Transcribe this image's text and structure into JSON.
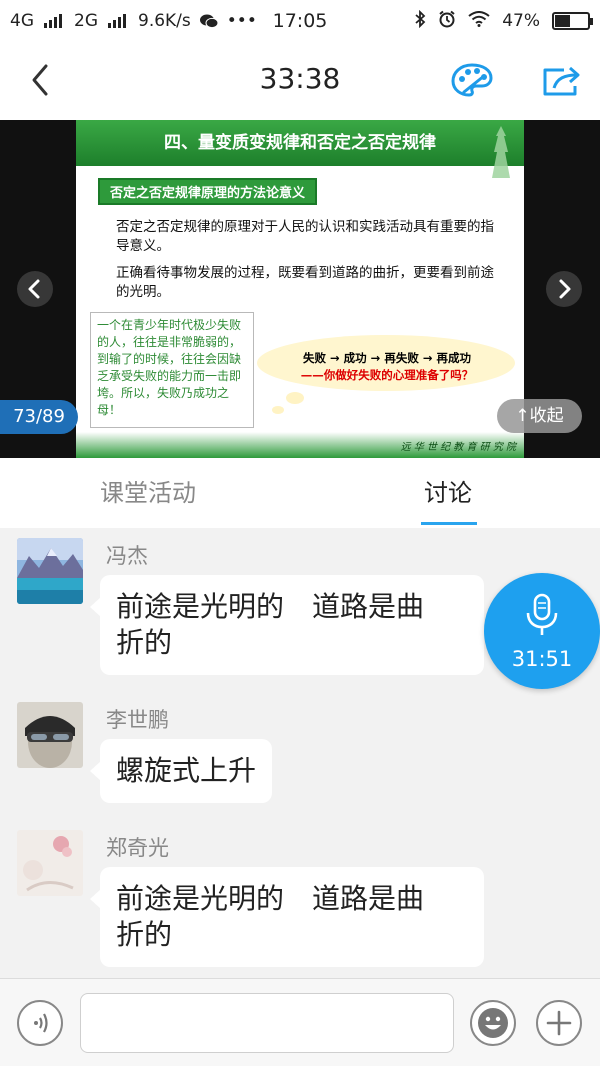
{
  "status_bar": {
    "network_1": "4G",
    "network_2": "2G",
    "speed": "9.6K/s",
    "more": "•••",
    "time": "17:05",
    "battery": "47%",
    "battery_level": 0.47
  },
  "header": {
    "title": "33:38",
    "back_icon": "chevron-left-icon",
    "palette_icon": "palette-icon",
    "share_icon": "share-icon",
    "accent_color": "#1e9be9"
  },
  "slide": {
    "title": "四、量变质变规律和否定之否定规律",
    "subtitle": "否定之否定规律原理的方法论意义",
    "paragraph_1": "否定之否定规律的原理对于人民的认识和实践活动具有重要的指导意义。",
    "paragraph_2": "正确看待事物发展的过程，既要看到道路的曲折，更要看到前途的光明。",
    "box_text": "一个在青少年时代极少失败的人，往往是非常脆弱的，到输了的时候，往往会因缺乏承受失败的能力而一击即垮。所以，失败乃成功之母！",
    "flow": "失败 → 成功 → 再失败 → 再成功",
    "flow_question": "——你做好失败的心理准备了吗？",
    "footer_text": "远 华 世 纪 教 育 研 究 院",
    "page_indicator": "73/89",
    "collapse_label": "↑收起",
    "prev_icon": "chevron-left-icon",
    "next_icon": "chevron-right-icon"
  },
  "tabs": [
    {
      "label": "课堂活动",
      "active": false
    },
    {
      "label": "讨论",
      "active": true
    }
  ],
  "messages": [
    {
      "sender": "冯杰",
      "lines": [
        "前途是光明的　道路是曲",
        "折的"
      ],
      "avatar": "mountain-lake-avatar"
    },
    {
      "sender": "李世鹏",
      "lines": [
        "螺旋式上升"
      ],
      "avatar": "person-avatar"
    },
    {
      "sender": "郑奇光",
      "lines": [
        "前途是光明的　道路是曲",
        "折的"
      ],
      "avatar": "floral-avatar"
    }
  ],
  "recorder": {
    "time": "31:51",
    "icon": "microphone-icon"
  },
  "bottom_bar": {
    "input_value": "",
    "input_placeholder": "",
    "voice_icon": "voice-icon",
    "emoji_icon": "emoji-icon",
    "plus_icon": "plus-icon"
  }
}
